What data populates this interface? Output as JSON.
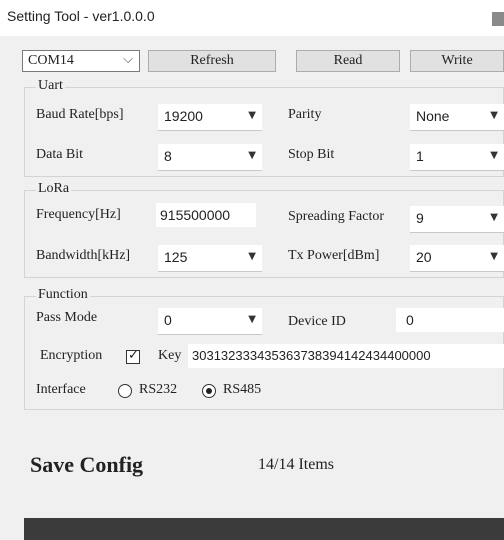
{
  "window": {
    "title": "Setting Tool - ver1.0.0.0"
  },
  "toolbar": {
    "port_value": "COM14",
    "refresh_label": "Refresh",
    "read_label": "Read",
    "write_label": "Write"
  },
  "uart": {
    "legend": "Uart",
    "baud_label": "Baud Rate[bps]",
    "baud_value": "19200",
    "parity_label": "Parity",
    "parity_value": "None",
    "databit_label": "Data Bit",
    "databit_value": "8",
    "stopbit_label": "Stop Bit",
    "stopbit_value": "1"
  },
  "lora": {
    "legend": "LoRa",
    "freq_label": "Frequency[Hz]",
    "freq_value": "915500000",
    "sf_label": "Spreading Factor",
    "sf_value": "9",
    "bw_label": "Bandwidth[kHz]",
    "bw_value": "125",
    "tx_label": "Tx Power[dBm]",
    "tx_value": "20"
  },
  "function": {
    "legend": "Function",
    "passmode_label": "Pass Mode",
    "passmode_value": "0",
    "deviceid_label": "Device ID",
    "deviceid_value": "0",
    "encryption_label": "Encryption",
    "encryption_checked": true,
    "key_label": "Key",
    "key_value": "303132333435363738394142434400000",
    "interface_label": "Interface",
    "rs232_label": "RS232",
    "rs485_label": "RS485",
    "interface_selected": "RS485"
  },
  "save": {
    "title": "Save Config",
    "count": "14/14 Items",
    "progress": 1.0
  },
  "colors": {
    "progress": "#3b3b3b",
    "background": "#f0f0f0"
  },
  "icons": {
    "combo_chevron": "chevron-down-icon",
    "dropdown_arrow": "caret-down-icon"
  }
}
